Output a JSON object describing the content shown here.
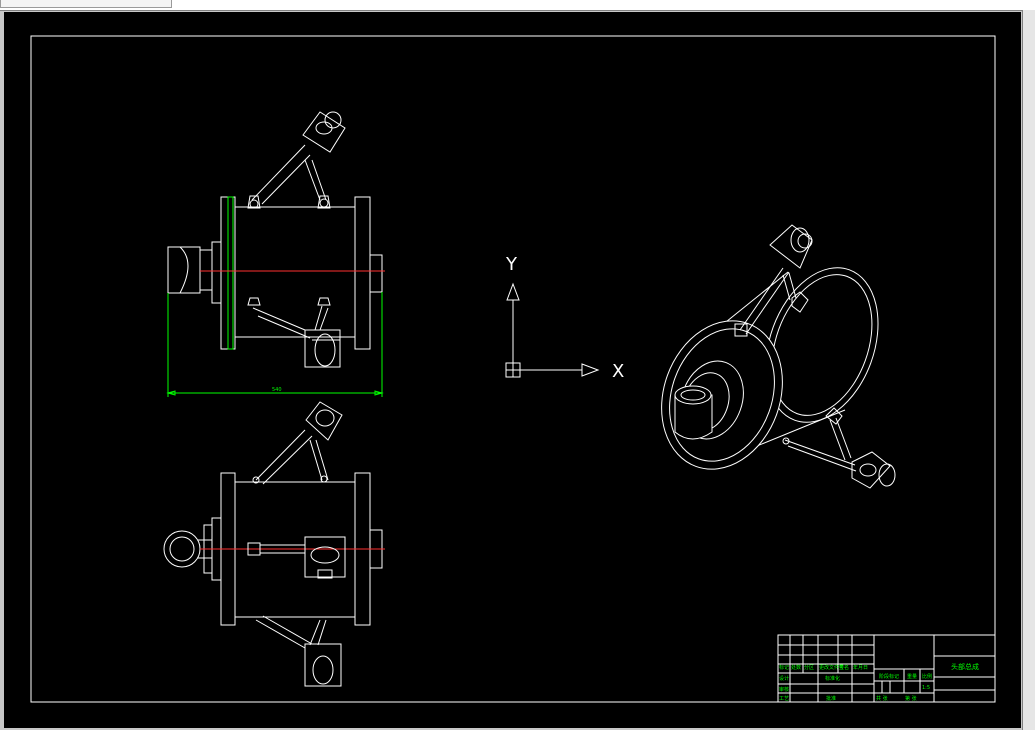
{
  "window": {
    "tab_text": "",
    "background": "#000000",
    "line_color": "#ffffff",
    "accent_color": "#00ff00",
    "centerline_color": "#ff3030"
  },
  "ucs": {
    "y_label": "Y",
    "x_label": "X"
  },
  "dimension": {
    "text": "540"
  },
  "title_block": {
    "drawing_name": "头部总成",
    "row_labels": [
      "标记",
      "处数",
      "分区",
      "更改文件号",
      "签名",
      "年月日"
    ],
    "designer_label": "设计",
    "standard_label": "标准化",
    "review_label": "审核",
    "process_label": "工艺",
    "approve_label": "批准",
    "stage_label": "阶段标记",
    "weight_label": "重量",
    "scale_label": "比例",
    "scale_value": "1:5",
    "sheet_total": "共 张",
    "sheet_no": "第 张"
  }
}
